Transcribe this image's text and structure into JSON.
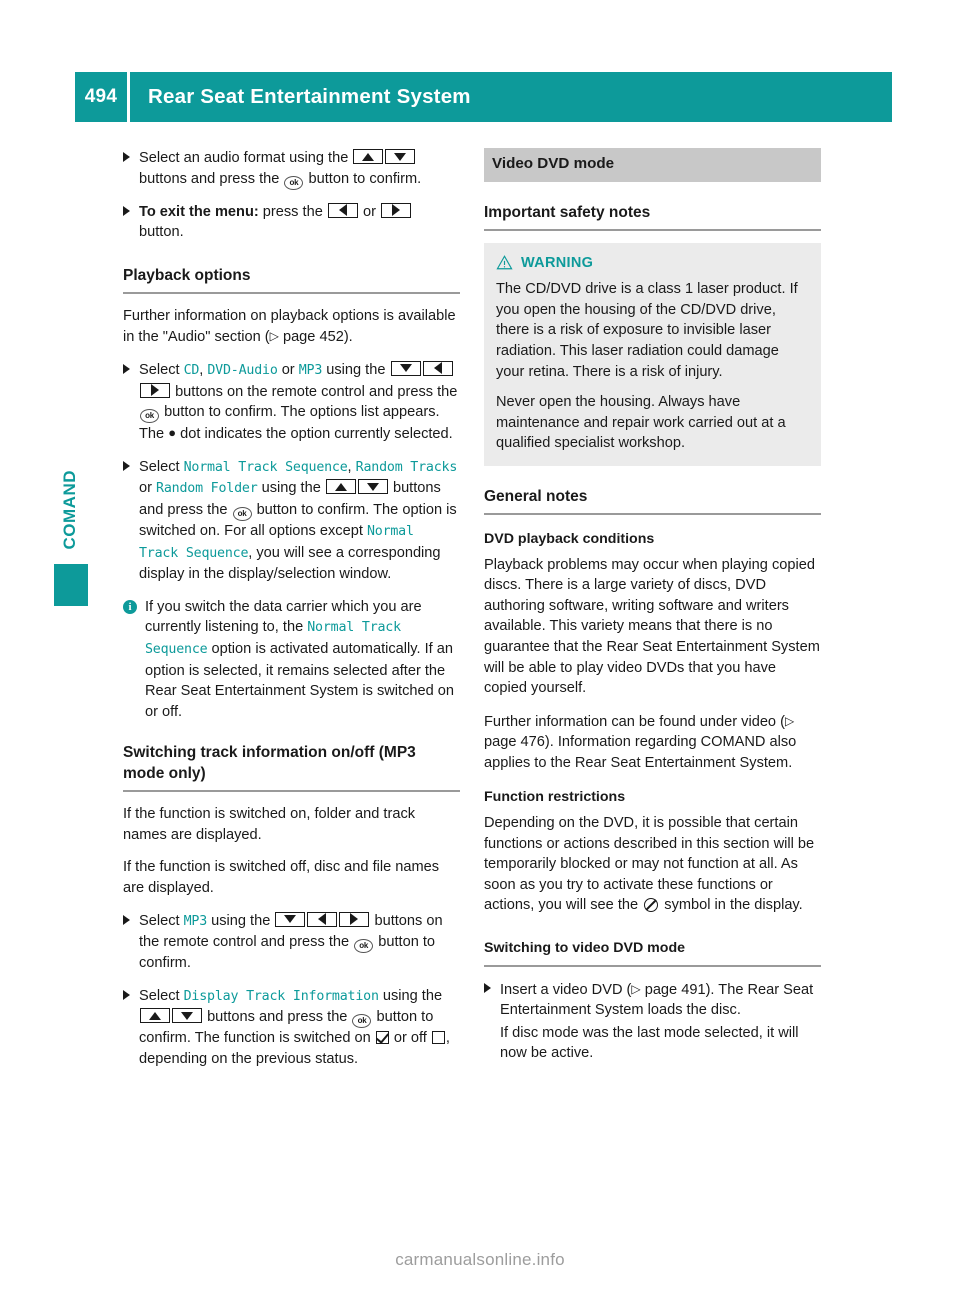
{
  "header": {
    "page_number": "494",
    "title": "Rear Seat Entertainment System"
  },
  "side_tab": {
    "label": "COMAND"
  },
  "footer": {
    "watermark": "carmanualsonline.info"
  },
  "colors": {
    "teal": "#0d9a9a",
    "band_gray": "#c8c8c8",
    "warn_bg": "#ebebeb",
    "rule_gray": "#9a9a9a"
  },
  "left_column": {
    "step_audio_format": {
      "t1": "Select an audio format using the",
      "t2": "buttons and press the",
      "t3": "button to confirm."
    },
    "step_exit_menu": {
      "bold": "To exit the menu:",
      "t1": "press the",
      "t2": "or",
      "t3": "button."
    },
    "heading_playback_options": "Playback options",
    "para_further_info": {
      "t1": "Further information on playback options is available in the \"Audio\" section (",
      "t2": "page 452)."
    },
    "step_select_cd": {
      "t1": "Select",
      "opt1": "CD",
      "sep1": ",",
      "opt2": "DVD-Audio",
      "sep2": "or",
      "opt3": "MP3",
      "t2": "using the",
      "t3": "buttons on the remote control and press the",
      "t4": "button to confirm. The options list appears. The",
      "t5": "dot indicates the option currently selected."
    },
    "step_select_sequence": {
      "t1": "Select",
      "opt1": "Normal Track Sequence",
      "sep1": ",",
      "opt2": "Random Tracks",
      "sep2": "or",
      "opt3": "Random Folder",
      "t2": "using the",
      "t3": "buttons and press the",
      "t4": "button to confirm.",
      "t5": "The option is switched on. For all options except",
      "opt4": "Normal Track Sequence",
      "t6": ", you will see a corresponding display in the display/selection window."
    },
    "note_data_carrier": {
      "t1": "If you switch the data carrier which you are currently listening to, the",
      "opt1": "Normal Track Sequence",
      "t2": "option is activated automatically. If an option is selected, it remains selected after the Rear Seat Entertainment System is switched on or off."
    },
    "heading_switching_track_info": "Switching track information on/off (MP3 mode only)",
    "para_switched_on": "If the function is switched on, folder and track names are displayed.",
    "para_switched_off": "If the function is switched off, disc and file names are displayed.",
    "step_select_mp3": {
      "t1": "Select",
      "opt1": "MP3",
      "t2": "using the",
      "t3": "buttons on the remote control and press the",
      "t4": "button to confirm."
    },
    "step_display_track_info": {
      "t1": "Select",
      "opt1": "Display Track Information",
      "t2": "using the",
      "t3": "buttons and press the",
      "t4": "button to confirm.",
      "t5": "The function is switched on",
      "t6": "or off",
      "t7": ", depending on the previous status."
    }
  },
  "right_column": {
    "band_video_dvd_mode": "Video DVD mode",
    "heading_safety_notes": "Important safety notes",
    "warning": {
      "label": "WARNING",
      "para1": "The CD/DVD drive is a class 1 laser product. If you open the housing of the CD/DVD drive, there is a risk of exposure to invisible laser radiation. This laser radiation could damage your retina. There is a risk of injury.",
      "para2": "Never open the housing. Always have maintenance and repair work carried out at a qualified specialist workshop."
    },
    "heading_general_notes": "General notes",
    "sub_dvd_playback_conditions": "DVD playback conditions",
    "para_playback_problems": "Playback problems may occur when playing copied discs. There is a large variety of discs, DVD authoring software, writing software and writers available. This variety means that there is no guarantee that the Rear Seat Entertainment System will be able to play video DVDs that you have copied yourself.",
    "para_further_info": {
      "t1": "Further information can be found under video (",
      "t2": "page 476). Information regarding COMAND also applies to the Rear Seat Entertainment System."
    },
    "sub_function_restrictions": "Function restrictions",
    "para_restrictions": {
      "t1": "Depending on the DVD, it is possible that certain functions or actions described in this section will be temporarily blocked or may not function at all. As soon as you try to activate these functions or actions, you will see the",
      "t2": "symbol in the display."
    },
    "sub_switching_video_dvd": "Switching to video DVD mode",
    "step_insert_dvd": {
      "t1": "Insert a video DVD (",
      "t2": "page 491).",
      "t3": "The Rear Seat Entertainment System loads the disc."
    },
    "para_disc_mode": "If disc mode was the last mode selected, it will now be active."
  }
}
